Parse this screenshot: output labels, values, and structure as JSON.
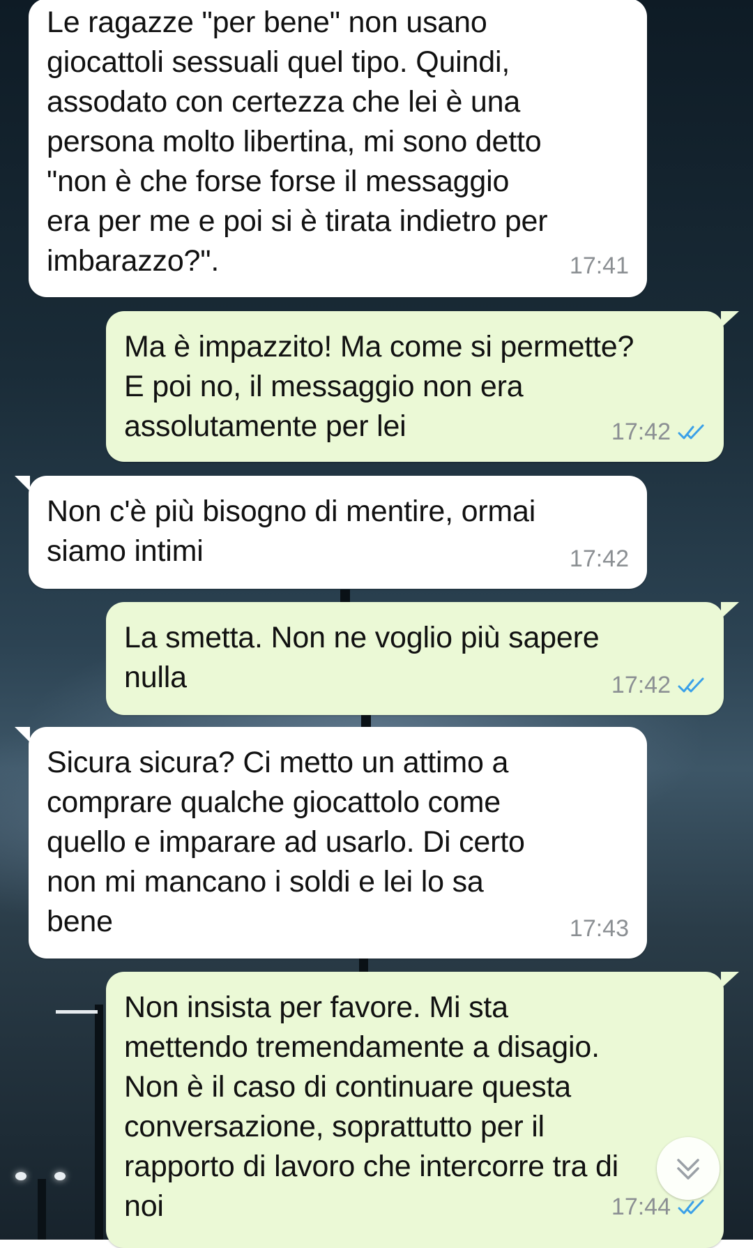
{
  "messages": [
    {
      "direction": "in",
      "text": "Le ragazze \"per bene\" non usano\ngiocattoli sessuali quel tipo. Quindi,\nassodato con certezza che lei è una\npersona molto libertina, mi sono detto\n\"non è che forse forse il messaggio\nera per me e poi si è tirata indietro per\nimbarazzo?\".",
      "time": "17:41"
    },
    {
      "direction": "out",
      "text": "Ma è impazzito! Ma come si permette?\nE poi no, il messaggio non era\nassolutamente per lei",
      "time": "17:42",
      "status": "read-double-check"
    },
    {
      "direction": "in",
      "text": "Non c'è più bisogno di mentire, ormai\nsiamo intimi",
      "time": "17:42"
    },
    {
      "direction": "out",
      "text": "La smetta. Non ne voglio più sapere\nnulla",
      "time": "17:42",
      "status": "read-double-check"
    },
    {
      "direction": "in",
      "text": "Sicura sicura? Ci metto un attimo a\ncomprare qualche giocattolo come\nquello e imparare ad usarlo. Di certo\nnon mi mancano i soldi e lei lo sa\nbene",
      "time": "17:43"
    },
    {
      "direction": "out",
      "text": "Non insista per favore. Mi sta\nmettendo tremendamente a disagio.\nNon è il caso di continuare questa\nconversazione, soprattutto per il\nrapporto di lavoro che intercorre tra di\nnoi",
      "time": "17:44",
      "status": "read-double-check"
    }
  ],
  "icons": {
    "read_status": "double-check-icon",
    "scroll": "chevron-double-down-icon"
  },
  "colors": {
    "incoming_bubble": "#ffffff",
    "outgoing_bubble": "#ebf9d6",
    "timestamp": "#8b8f93",
    "read_ticks": "#3aa0e8"
  }
}
